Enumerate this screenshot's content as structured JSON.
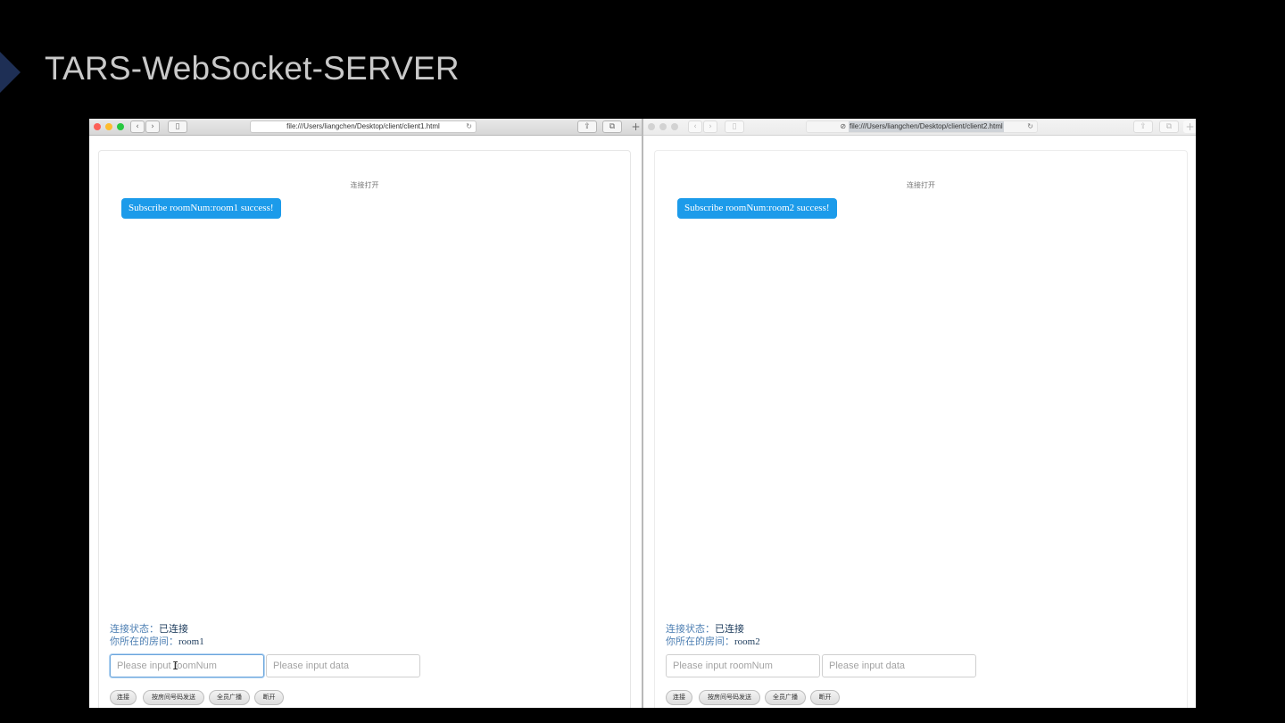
{
  "slide": {
    "title": "TARS-WebSocket-SERVER"
  },
  "windows": [
    {
      "address": "file:///Users/liangchen/Desktop/client/client1.html",
      "status_text": "连接打开",
      "bubble": "Subscribe roomNum:room1 success!",
      "connection_label": "连接状态：",
      "connection_value": "已连接",
      "room_label": "你所在的房间：",
      "room_value": "room1",
      "room_placeholder": "Please input roomNum",
      "data_placeholder": "Please input data",
      "buttons": {
        "connect": "连接",
        "send_room": "按房间号码发送",
        "broadcast": "全员广播",
        "disconnect": "断开"
      }
    },
    {
      "address": "file:///Users/liangchen/Desktop/client/client2.html",
      "status_text": "连接打开",
      "bubble": "Subscribe roomNum:room2 success!",
      "connection_label": "连接状态：",
      "connection_value": "已连接",
      "room_label": "你所在的房间：",
      "room_value": "room2",
      "room_placeholder": "Please input roomNum",
      "data_placeholder": "Please input data",
      "buttons": {
        "connect": "连接",
        "send_room": "按房间号码发送",
        "broadcast": "全员广播",
        "disconnect": "断开"
      }
    }
  ],
  "icons": {
    "back": "‹",
    "forward": "›",
    "sidebar": "▯",
    "share": "⇪",
    "tabs": "⧉",
    "new_tab": "+",
    "reload": "↻",
    "compass": "⊘",
    "cursor": "I"
  },
  "colors": {
    "bubble": "#1c9bea",
    "info_label": "#4d7fb3",
    "slide_marker": "#1e2f55"
  }
}
